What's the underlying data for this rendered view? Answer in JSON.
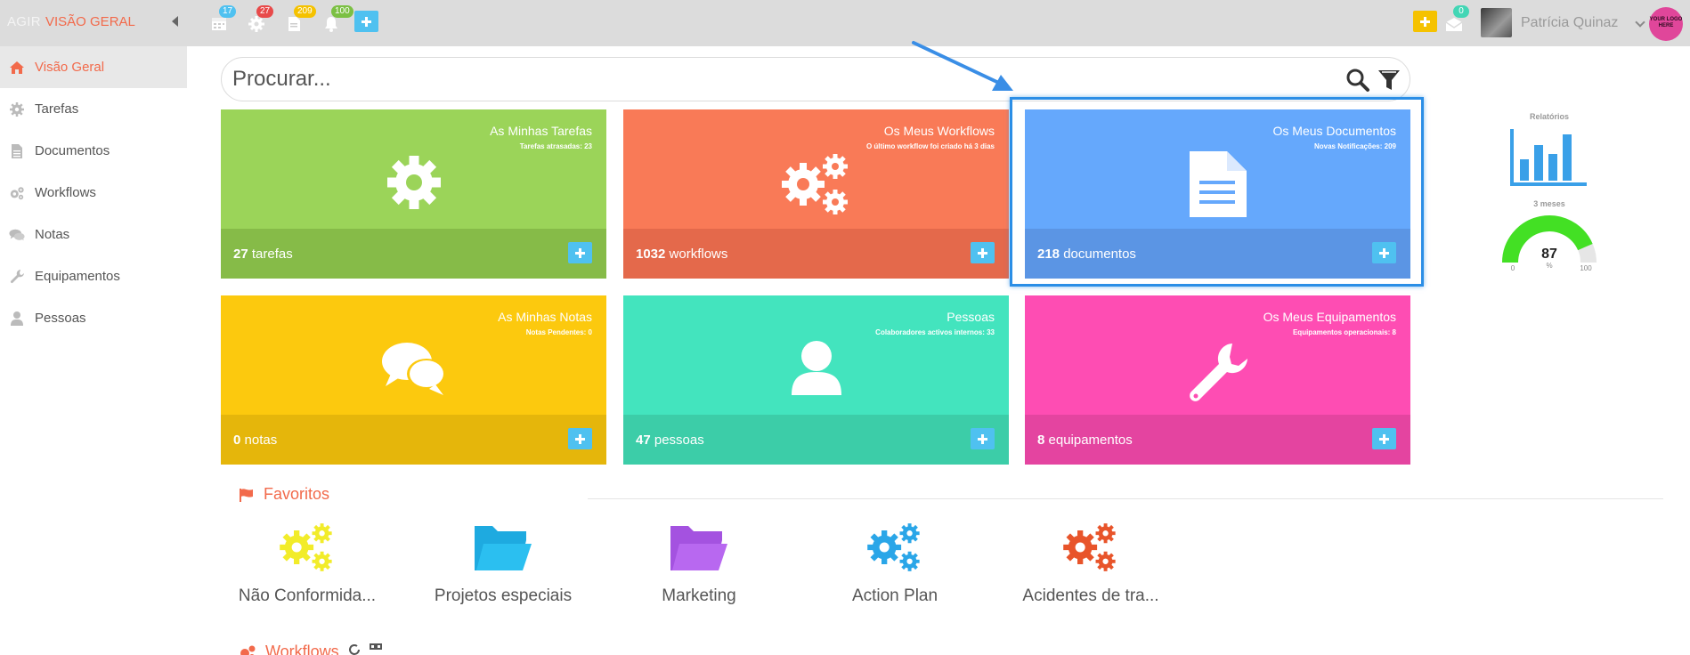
{
  "topbar": {
    "brand": "AGIR",
    "view_title": "VISÃO GERAL",
    "badges": {
      "calendar": "17",
      "tasks": "27",
      "documents": "209",
      "notifications": "100",
      "messages": "0"
    },
    "user_name": "Patrícia Quinaz",
    "logo_text": "YOUR LOGO HERE",
    "colors": {
      "badge_calendar": "#4fc1f0",
      "badge_tasks": "#e84a4a",
      "badge_documents": "#f5c200",
      "badge_notifications": "#7bc043",
      "add_blue": "#4fc1f0",
      "add_yellow": "#f5c200"
    }
  },
  "sidebar": {
    "items": [
      {
        "label": "Visão Geral",
        "icon": "home-icon",
        "active": true
      },
      {
        "label": "Tarefas",
        "icon": "gear-icon",
        "active": false
      },
      {
        "label": "Documentos",
        "icon": "document-icon",
        "active": false
      },
      {
        "label": "Workflows",
        "icon": "gears-icon",
        "active": false
      },
      {
        "label": "Notas",
        "icon": "comments-icon",
        "active": false
      },
      {
        "label": "Equipamentos",
        "icon": "wrench-icon",
        "active": false
      },
      {
        "label": "Pessoas",
        "icon": "user-icon",
        "active": false
      }
    ]
  },
  "search": {
    "placeholder": "Procurar..."
  },
  "tiles": [
    {
      "title": "As Minhas Tarefas",
      "subtitle": "Tarefas atrasadas: 23",
      "count": "27",
      "unit": "tarefas",
      "icon": "gear-icon",
      "color": "#9bd459",
      "footer_color": "#86bb48"
    },
    {
      "title": "Os Meus Workflows",
      "subtitle": "O último workflow foi criado há 3 dias",
      "count": "1032",
      "unit": "workflows",
      "icon": "gears-icon",
      "color": "#f97a57",
      "footer_color": "#e4694b"
    },
    {
      "title": "Os Meus Documentos",
      "subtitle": "Novas Notificações: 209",
      "count": "218",
      "unit": "documentos",
      "icon": "document-icon",
      "color": "#65a8fc",
      "footer_color": "#5b95e4"
    },
    {
      "title": "As Minhas Notas",
      "subtitle": "Notas Pendentes: 0",
      "count": "0",
      "unit": "notas",
      "icon": "comments-icon",
      "color": "#fcc90e",
      "footer_color": "#e5b60b"
    },
    {
      "title": "Pessoas",
      "subtitle": "Colaboradores activos internos: 33",
      "count": "47",
      "unit": "pessoas",
      "icon": "user-icon",
      "color": "#43e4be",
      "footer_color": "#3ccda8"
    },
    {
      "title": "Os Meus Equipamentos",
      "subtitle": "Equipamentos operacionais: 8",
      "count": "8",
      "unit": "equipamentos",
      "icon": "wrench-icon",
      "color": "#fe4db3",
      "footer_color": "#e444a0"
    }
  ],
  "widgets": {
    "reports_label": "Relatórios",
    "period_label": "3 meses",
    "gauge": {
      "value": "87",
      "unit": "%",
      "min": "0",
      "max": "100",
      "fraction": 0.87
    }
  },
  "favorites": {
    "title": "Favoritos",
    "items": [
      {
        "label": "Não Conformida...",
        "icon": "gears-icon",
        "color": "#f2ec2a"
      },
      {
        "label": "Projetos especiais",
        "icon": "folder-open-icon",
        "color": "#1eaae0"
      },
      {
        "label": "Marketing",
        "icon": "folder-open-icon",
        "color": "#b060e8"
      },
      {
        "label": "Action Plan",
        "icon": "gears-icon",
        "color": "#2aa6e8"
      },
      {
        "label": "Acidentes de tra...",
        "icon": "gears-icon",
        "color": "#e8542a"
      }
    ]
  },
  "workflows_section": {
    "title": "Workflows"
  }
}
